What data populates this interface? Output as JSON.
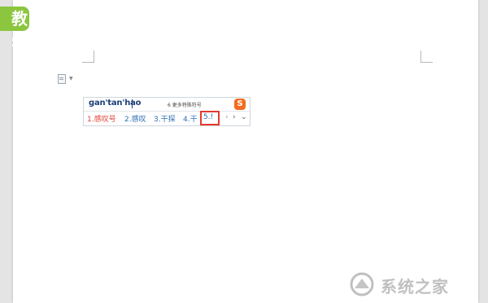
{
  "badge": {
    "text": "教学"
  },
  "ime": {
    "input_text": "gan'tan'hao",
    "more_symbols_hint": "6 更多特殊符号",
    "logo_letter": "S",
    "candidates": [
      {
        "label": "1.感叹号"
      },
      {
        "label": "2.感叹"
      },
      {
        "label": "3.干探"
      },
      {
        "label": "4.干"
      },
      {
        "label": "5.!"
      }
    ],
    "nav_prev": "‹",
    "nav_next": "›",
    "nav_expand": "⌄"
  },
  "watermark": {
    "text": "系统之家"
  },
  "colors": {
    "badge_green": "#8cc63f",
    "highlight_red": "#e23b2e",
    "sogou_orange": "#f36c21",
    "candidate_blue": "#2e6fb5",
    "first_candidate_red": "#e0453b"
  }
}
